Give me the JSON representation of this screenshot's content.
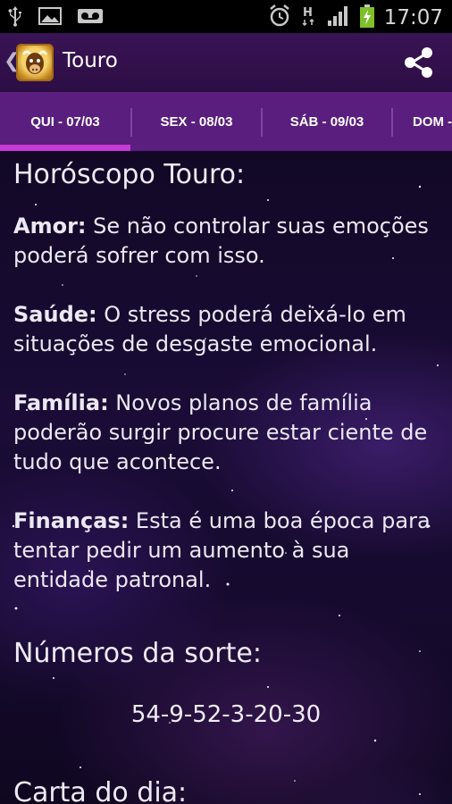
{
  "status_bar": {
    "time": "17:07",
    "icons": [
      "usb-icon",
      "image-icon",
      "voicemail-icon",
      "alarm-icon",
      "h-data-icon",
      "signal-icon",
      "battery-charging-icon"
    ]
  },
  "action_bar": {
    "title": "Touro",
    "up_icon": "chevron-left-icon",
    "logo": "taurus-logo",
    "share_icon": "share-icon"
  },
  "tabs": [
    {
      "label": "QUI - 07/03",
      "selected": true
    },
    {
      "label": "SEX - 08/03",
      "selected": false
    },
    {
      "label": "SÁB - 09/03",
      "selected": false
    },
    {
      "label": "DOM -",
      "selected": false
    }
  ],
  "content": {
    "heading": "Horóscopo Touro:",
    "sections": [
      {
        "label": "Amor:",
        "text": " Se não controlar suas emoções poderá sofrer com isso."
      },
      {
        "label": "Saúde:",
        "text": " O stress poderá deixá-lo em situações de desgaste emocional."
      },
      {
        "label": "Família:",
        "text": " Novos planos de família poderão surgir procure estar ciente de tudo que acontece."
      },
      {
        "label": "Finanças:",
        "text": " Esta é uma boa época para tentar pedir um aumento à sua entidade patronal."
      }
    ],
    "lucky_heading": "Números da sorte:",
    "lucky_numbers": "54-9-52-3-20-30",
    "card_heading": "Carta do dia:"
  },
  "colors": {
    "tab_bar": "#5a1f7e",
    "action_bar": "#3a1455",
    "tab_indicator": "#c43bd6"
  }
}
